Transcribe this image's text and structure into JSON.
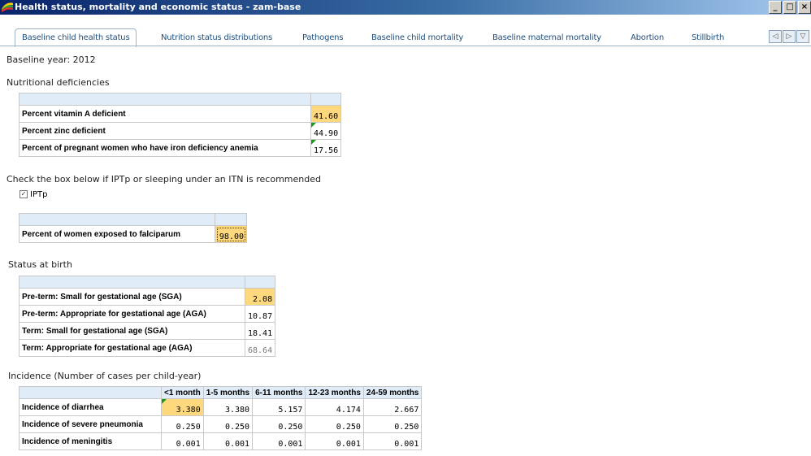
{
  "window": {
    "title": "Health status, mortality and economic status - zam-base",
    "controls": [
      "_",
      "□",
      "×"
    ]
  },
  "tabs": [
    {
      "label": "Baseline child health status",
      "active": true
    },
    {
      "label": "Nutrition status distributions",
      "active": false
    },
    {
      "label": "Pathogens",
      "active": false
    },
    {
      "label": "Baseline child mortality",
      "active": false
    },
    {
      "label": "Baseline maternal mortality",
      "active": false
    },
    {
      "label": "Abortion",
      "active": false
    },
    {
      "label": "Stillbirth",
      "active": false
    }
  ],
  "tab_nav": [
    "◁",
    "▷",
    "▽"
  ],
  "baseline_year": "Baseline year: 2012",
  "nutrition": {
    "heading": "Nutritional deficiencies",
    "rows": [
      {
        "label": "Percent vitamin A deficient",
        "value": "41.60"
      },
      {
        "label": "Percent zinc deficient",
        "value": "44.90"
      },
      {
        "label": "Percent of pregnant women who have iron deficiency anemia",
        "value": "17.56"
      }
    ]
  },
  "iptn": {
    "instruction": "Check the box below if IPTp or sleeping under an ITN is recommended",
    "checkbox_label": "IPTp",
    "checked": true,
    "row": {
      "label": "Percent of women exposed to falciparum",
      "value": "98.00"
    }
  },
  "birth": {
    "heading": "Status at birth",
    "rows": [
      {
        "label": "Pre-term: Small for gestational age (SGA)",
        "value": "2.08"
      },
      {
        "label": "Pre-term: Appropriate for gestational age (AGA)",
        "value": "10.87"
      },
      {
        "label": "Term: Small for gestational age (SGA)",
        "value": "18.41"
      },
      {
        "label": "Term: Appropriate for gestational age (AGA)",
        "value": "68.64"
      }
    ]
  },
  "incidence": {
    "heading": "Incidence (Number of cases per child-year)",
    "columns": [
      "<1 month",
      "1-5 months",
      "6-11 months",
      "12-23 months",
      "24-59 months"
    ],
    "rows": [
      {
        "label": "Incidence of diarrhea",
        "values": [
          "3.380",
          "3.380",
          "5.157",
          "4.174",
          "2.667"
        ]
      },
      {
        "label": "Incidence of severe pneumonia",
        "values": [
          "0.250",
          "0.250",
          "0.250",
          "0.250",
          "0.250"
        ]
      },
      {
        "label": "Incidence of meningitis",
        "values": [
          "0.001",
          "0.001",
          "0.001",
          "0.001",
          "0.001"
        ]
      }
    ]
  },
  "colors": {
    "title_start": "#0a246a",
    "tab_text": "#1f4e79",
    "highlight": "#fdd87c",
    "marker": "#1a9a1a"
  }
}
